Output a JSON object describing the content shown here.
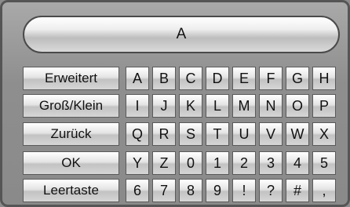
{
  "display": {
    "text": "A"
  },
  "function_keys": [
    "Erweitert",
    "Groß/Klein",
    "Zurück",
    "OK",
    "Leertaste"
  ],
  "char_rows": [
    [
      "A",
      "B",
      "C",
      "D",
      "E",
      "F",
      "G",
      "H"
    ],
    [
      "I",
      "J",
      "K",
      "L",
      "M",
      "N",
      "O",
      "P"
    ],
    [
      "Q",
      "R",
      "S",
      "T",
      "U",
      "V",
      "W",
      "X"
    ],
    [
      "Y",
      "Z",
      "0",
      "1",
      "2",
      "3",
      "4",
      "5"
    ],
    [
      "6",
      "7",
      "8",
      "9",
      "!",
      "?",
      "#",
      ","
    ]
  ]
}
